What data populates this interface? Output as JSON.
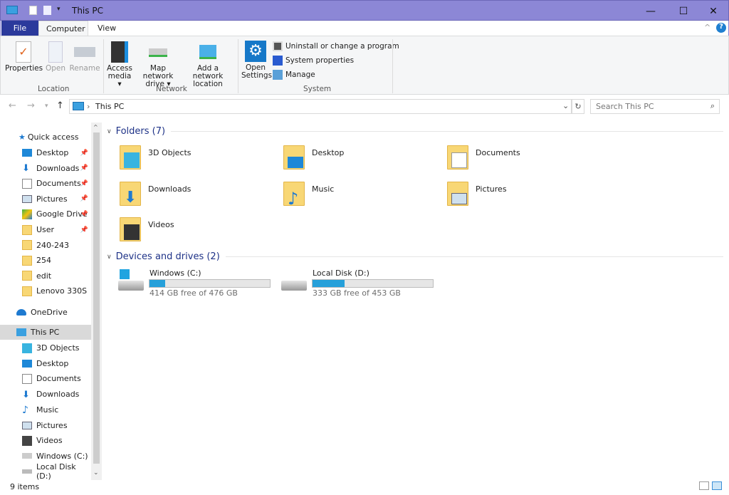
{
  "window": {
    "title": "This PC",
    "minimize": "—",
    "maximize": "☐",
    "close": "✕"
  },
  "ribbon_tabs": [
    "File",
    "Computer",
    "View"
  ],
  "ribbon": {
    "location": {
      "label": "Location",
      "buttons": [
        "Properties",
        "Open",
        "Rename"
      ]
    },
    "network": {
      "label": "Network",
      "access_media": [
        "Access",
        "media ▾"
      ],
      "map_drive": [
        "Map network",
        "drive ▾"
      ],
      "add_location": [
        "Add a network",
        "location"
      ]
    },
    "system": {
      "label": "System",
      "open_settings": [
        "Open",
        "Settings"
      ],
      "items": [
        "Uninstall or change a program",
        "System properties",
        "Manage"
      ]
    }
  },
  "address": {
    "path": "This PC",
    "search_placeholder": "Search This PC"
  },
  "nav": {
    "quick_access": "Quick access",
    "quick_items": [
      {
        "label": "Desktop",
        "pinned": true
      },
      {
        "label": "Downloads",
        "pinned": true
      },
      {
        "label": "Documents",
        "pinned": true
      },
      {
        "label": "Pictures",
        "pinned": true
      },
      {
        "label": "Google Drive",
        "pinned": true
      },
      {
        "label": "User",
        "pinned": true
      },
      {
        "label": "240-243"
      },
      {
        "label": "254"
      },
      {
        "label": "edit"
      },
      {
        "label": "Lenovo 330S"
      }
    ],
    "onedrive": "OneDrive",
    "this_pc": "This PC",
    "pc_items": [
      "3D Objects",
      "Desktop",
      "Documents",
      "Downloads",
      "Music",
      "Pictures",
      "Videos",
      "Windows (C:)",
      "Local Disk (D:)"
    ]
  },
  "content": {
    "folders_header": "Folders (7)",
    "folders": [
      "3D Objects",
      "Desktop",
      "Documents",
      "Downloads",
      "Music",
      "Pictures",
      "Videos"
    ],
    "devices_header": "Devices and drives (2)",
    "drives": [
      {
        "name": "Windows (C:)",
        "free": "414 GB free of 476 GB",
        "used_fraction": 0.13
      },
      {
        "name": "Local Disk (D:)",
        "free": "333 GB free of 453 GB",
        "used_fraction": 0.265
      }
    ]
  },
  "status": {
    "items": "9 items"
  },
  "colors": {
    "titlebar": "#8c87d6",
    "file_tab": "#2b3a9c",
    "accent": "#26a0da"
  }
}
